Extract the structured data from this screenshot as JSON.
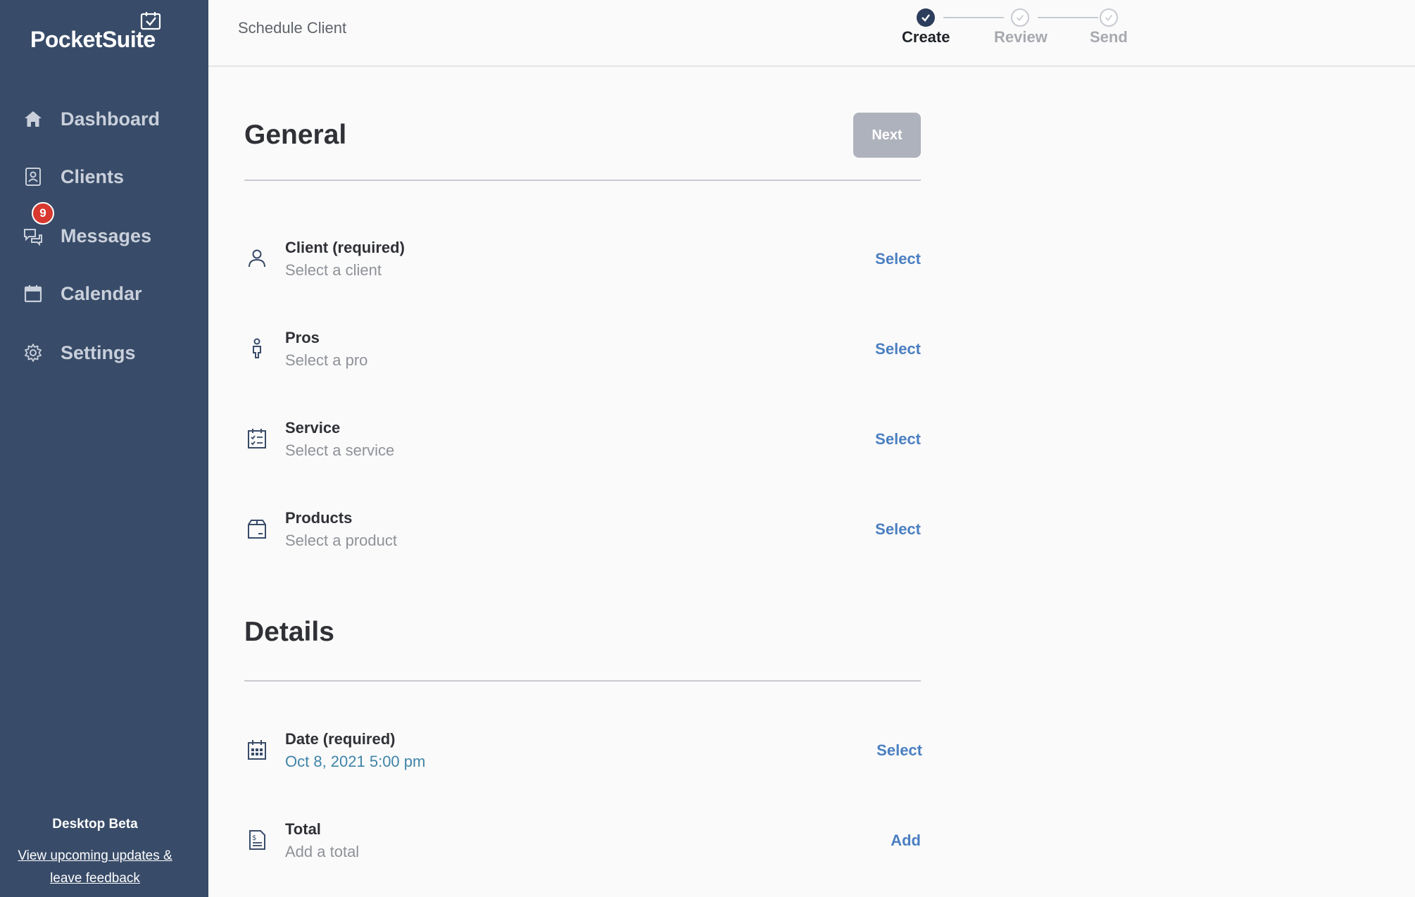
{
  "app": {
    "brand": "PocketSuite",
    "page_title": "Schedule Client"
  },
  "sidebar": {
    "items": [
      {
        "label": "Dashboard",
        "icon": "home-icon"
      },
      {
        "label": "Clients",
        "icon": "contact-card-icon"
      },
      {
        "label": "Messages",
        "icon": "chat-bubbles-icon",
        "badge": "9"
      },
      {
        "label": "Calendar",
        "icon": "calendar-icon"
      },
      {
        "label": "Settings",
        "icon": "gear-icon"
      }
    ],
    "beta_title": "Desktop Beta",
    "beta_link": "View upcoming updates & leave feedback"
  },
  "stepper": {
    "steps": [
      {
        "label": "Create",
        "state": "active"
      },
      {
        "label": "Review",
        "state": "inactive"
      },
      {
        "label": "Send",
        "state": "inactive"
      }
    ]
  },
  "general": {
    "title": "General",
    "next_label": "Next",
    "rows": [
      {
        "label": "Client (required)",
        "value": "Select a client",
        "action": "Select",
        "icon": "person-icon"
      },
      {
        "label": "Pros",
        "value": "Select a pro",
        "action": "Select",
        "icon": "pro-person-icon"
      },
      {
        "label": "Service",
        "value": "Select a service",
        "action": "Select",
        "icon": "checklist-icon"
      },
      {
        "label": "Products",
        "value": "Select a product",
        "action": "Select",
        "icon": "box-icon"
      }
    ]
  },
  "details": {
    "title": "Details",
    "rows": [
      {
        "label": "Date (required)",
        "value": "Oct 8, 2021 5:00 pm",
        "action": "Select",
        "icon": "calendar-grid-icon"
      },
      {
        "label": "Total",
        "value": "Add a total",
        "action": "Add",
        "icon": "invoice-icon"
      }
    ]
  },
  "colors": {
    "sidebar_bg": "#384b68",
    "accent": "#4a7fc1",
    "badge": "#d7382f",
    "step_active": "#2c3e5c"
  }
}
